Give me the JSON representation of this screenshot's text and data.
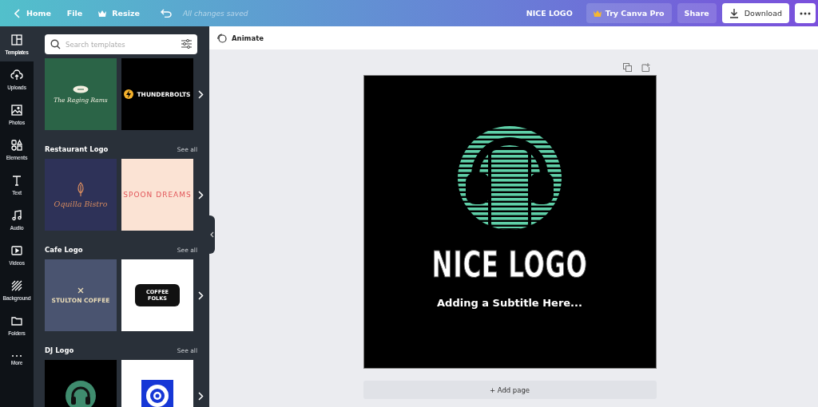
{
  "topbar": {
    "home": "Home",
    "file": "File",
    "resize": "Resize",
    "save_status": "All changes saved",
    "title": "NICE LOGO",
    "try_pro": "Try Canva Pro",
    "share": "Share",
    "download": "Download"
  },
  "rail": [
    {
      "kind": "templates",
      "label": "Templates",
      "selected": true
    },
    {
      "kind": "uploads",
      "label": "Uploads",
      "selected": false
    },
    {
      "kind": "photos",
      "label": "Photos",
      "selected": false
    },
    {
      "kind": "elements",
      "label": "Elements",
      "selected": false
    },
    {
      "kind": "text",
      "label": "Text",
      "selected": false
    },
    {
      "kind": "audio",
      "label": "Audio",
      "selected": false
    },
    {
      "kind": "videos",
      "label": "Videos",
      "selected": false
    },
    {
      "kind": "background",
      "label": "Background",
      "selected": false
    },
    {
      "kind": "folders",
      "label": "Folders",
      "selected": false
    },
    {
      "kind": "more",
      "label": "More",
      "selected": false
    }
  ],
  "search": {
    "placeholder": "Search templates"
  },
  "sections": [
    {
      "templates": [
        {
          "kind": "sports",
          "title": "The Raging Rams"
        },
        {
          "kind": "bolt",
          "title": "THUNDERBOLTS"
        }
      ]
    },
    {
      "heading": "Restaurant Logo",
      "see_all": "See all",
      "templates": [
        {
          "kind": "bistro",
          "title": "Oquilla Bistro"
        },
        {
          "kind": "spoon",
          "title": "SPOON DREAMS"
        }
      ]
    },
    {
      "heading": "Cafe Logo",
      "see_all": "See all",
      "templates": [
        {
          "kind": "stulton",
          "title": "STULTON COFFEE"
        },
        {
          "kind": "folks",
          "title": "COFFEE FOLKS"
        }
      ]
    },
    {
      "heading": "DJ Logo",
      "see_all": "See all",
      "templates": [
        {
          "kind": "headphones"
        },
        {
          "kind": "target"
        }
      ]
    }
  ],
  "toolbar": {
    "animate": "Animate"
  },
  "design": {
    "title": "NICE LOGO",
    "subtitle": "Adding a Subtitle Here..."
  },
  "add_page": "+ Add page"
}
